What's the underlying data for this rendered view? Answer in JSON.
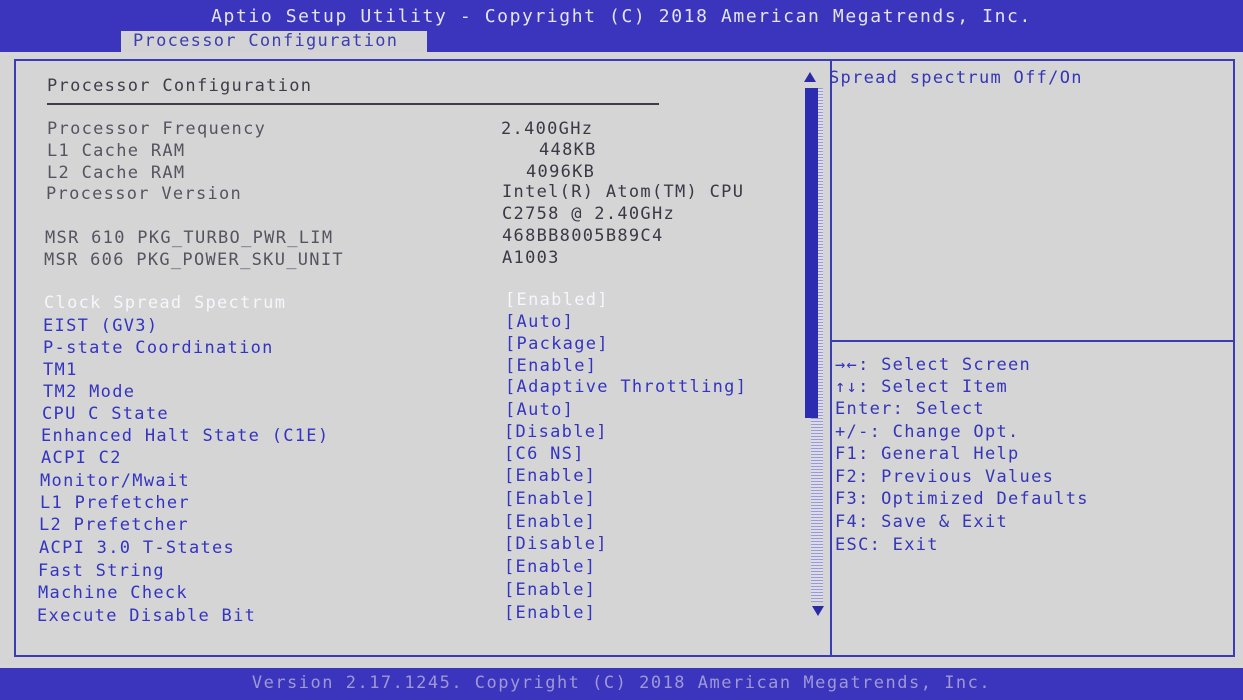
{
  "header": {
    "title": "Aptio Setup Utility - Copyright (C) 2018 American Megatrends, Inc.",
    "active_tab": "Processor Configuration"
  },
  "section": {
    "title": "Processor Configuration"
  },
  "info": [
    {
      "label": "Processor Frequency",
      "value": "2.400GHz"
    },
    {
      "label": "L1 Cache RAM",
      "value": "448KB"
    },
    {
      "label": "L2 Cache RAM",
      "value": "4096KB"
    },
    {
      "label": "Processor Version",
      "value": "Intel(R) Atom(TM) CPU"
    },
    {
      "label": "",
      "value": "C2758  @ 2.40GHz"
    },
    {
      "label": "MSR 610 PKG_TURBO_PWR_LIM",
      "value": "468BB8005B89C4"
    },
    {
      "label": "MSR 606 PKG_POWER_SKU_UNIT",
      "value": "A1003"
    }
  ],
  "settings": [
    {
      "label": "Clock Spread Spectrum",
      "value": "[Enabled]",
      "selected": true
    },
    {
      "label": "EIST (GV3)",
      "value": "[Auto]"
    },
    {
      "label": "P-state Coordination",
      "value": "[Package]"
    },
    {
      "label": "TM1",
      "value": "[Enable]"
    },
    {
      "label": "TM2 Mode",
      "value": "[Adaptive Throttling]"
    },
    {
      "label": "CPU C State",
      "value": "[Auto]"
    },
    {
      "label": "Enhanced Halt State (C1E)",
      "value": "[Disable]"
    },
    {
      "label": "ACPI C2",
      "value": "[C6 NS]"
    },
    {
      "label": "Monitor/Mwait",
      "value": "[Enable]"
    },
    {
      "label": "L1 Prefetcher",
      "value": "[Enable]"
    },
    {
      "label": "L2 Prefetcher",
      "value": "[Enable]"
    },
    {
      "label": "ACPI 3.0 T-States",
      "value": "[Disable]"
    },
    {
      "label": "Fast String",
      "value": "[Enable]"
    },
    {
      "label": "Machine Check",
      "value": "[Enable]"
    },
    {
      "label": "Execute Disable Bit",
      "value": "[Enable]"
    }
  ],
  "help_text": "Spread spectrum Off/On",
  "key_help": [
    "→←: Select Screen",
    "↑↓: Select Item",
    "Enter: Select",
    "+/-: Change Opt.",
    "F1: General Help",
    "F2: Previous Values",
    "F3: Optimized Defaults",
    "F4: Save & Exit",
    "ESC: Exit"
  ],
  "footer": {
    "version": "Version 2.17.1245. Copyright (C) 2018 American Megatrends, Inc."
  },
  "colors": {
    "bar": "#3b35bd",
    "background": "#d5d5d6",
    "item_text": "#3434c2",
    "selected_text": "#f6f6fb"
  }
}
